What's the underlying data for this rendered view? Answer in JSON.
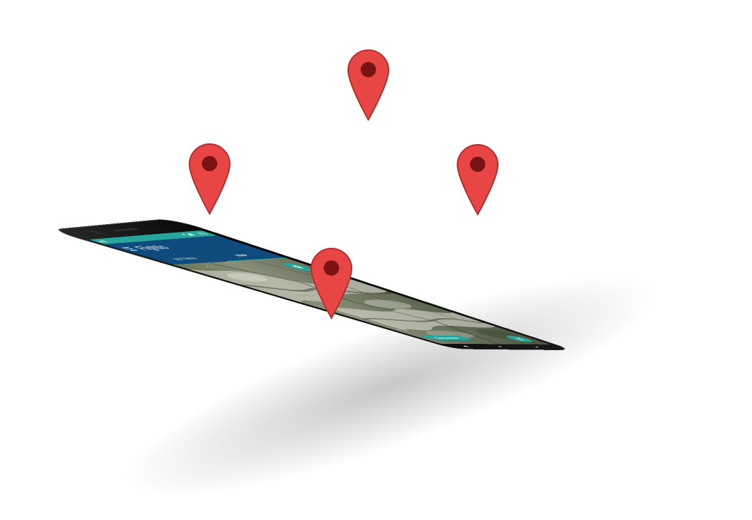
{
  "app": {
    "title": "Flightio",
    "status_time": "3:52",
    "accent_color": "#26a69a",
    "appbar_color": "#0f4c7d",
    "pin_color": "#e53935"
  },
  "tabs": [
    {
      "label": "SETTINGS",
      "selected": false
    },
    {
      "label": "MAP",
      "selected": true
    }
  ],
  "map": {
    "attribution": "Google",
    "labels": [
      "HAUTES-ALPES",
      "ALPES-DE-HAUTE-PROVENCE",
      "Cellier"
    ],
    "marker_count": 4
  },
  "buttons": {
    "generate": "Generate",
    "location_icon": "location-pin-icon",
    "camera_icon": "camera-icon",
    "share_icon": "share-icon"
  },
  "navbar": {
    "back": "◀",
    "home": "●",
    "recents": "■"
  }
}
